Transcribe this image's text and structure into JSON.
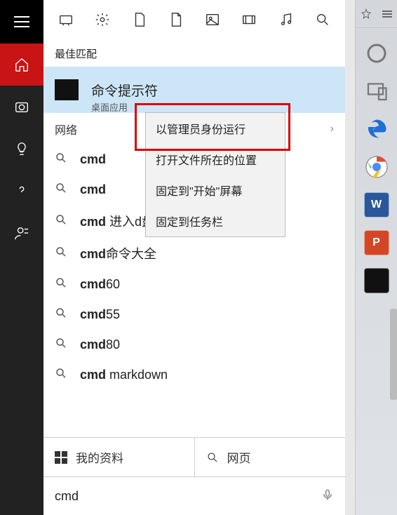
{
  "section_best_match": "最佳匹配",
  "best_match": {
    "title": "命令提示符",
    "subtitle": "桌面应用"
  },
  "sections": {
    "network": "网络"
  },
  "network_arrow": "›",
  "suggestions": [
    {
      "bold": "cmd",
      "rest": ""
    },
    {
      "bold": "cmd",
      "rest": ""
    },
    {
      "bold": "cmd",
      "rest": " 进入d盘"
    },
    {
      "bold": "cmd",
      "rest": "命令大全"
    },
    {
      "bold": "cmd",
      "rest": "60"
    },
    {
      "bold": "cmd",
      "rest": "55"
    },
    {
      "bold": "cmd",
      "rest": "80"
    },
    {
      "bold": "cmd",
      "rest": " markdown"
    }
  ],
  "context_menu": [
    "以管理员身份运行",
    "打开文件所在的位置",
    "固定到\"开始\"屏幕",
    "固定到任务栏"
  ],
  "bottom_tabs": {
    "my_stuff": "我的资料",
    "web": "网页"
  },
  "search_query": "cmd",
  "top_icon_names": [
    "recent-icon",
    "settings-icon",
    "file-icon",
    "file-outline-icon",
    "image-icon",
    "video-icon",
    "music-icon",
    "search-icon"
  ],
  "side_icon_names": [
    "home-icon",
    "camera-icon",
    "bulb-icon",
    "help-icon",
    "user-icon"
  ],
  "right_icons": [
    "cortana-icon",
    "devices-icon",
    "edge-icon",
    "chrome-icon",
    "word-icon",
    "powerpoint-icon",
    "cmd-icon"
  ],
  "right_labels": {
    "word": "W",
    "ppt": "P"
  }
}
